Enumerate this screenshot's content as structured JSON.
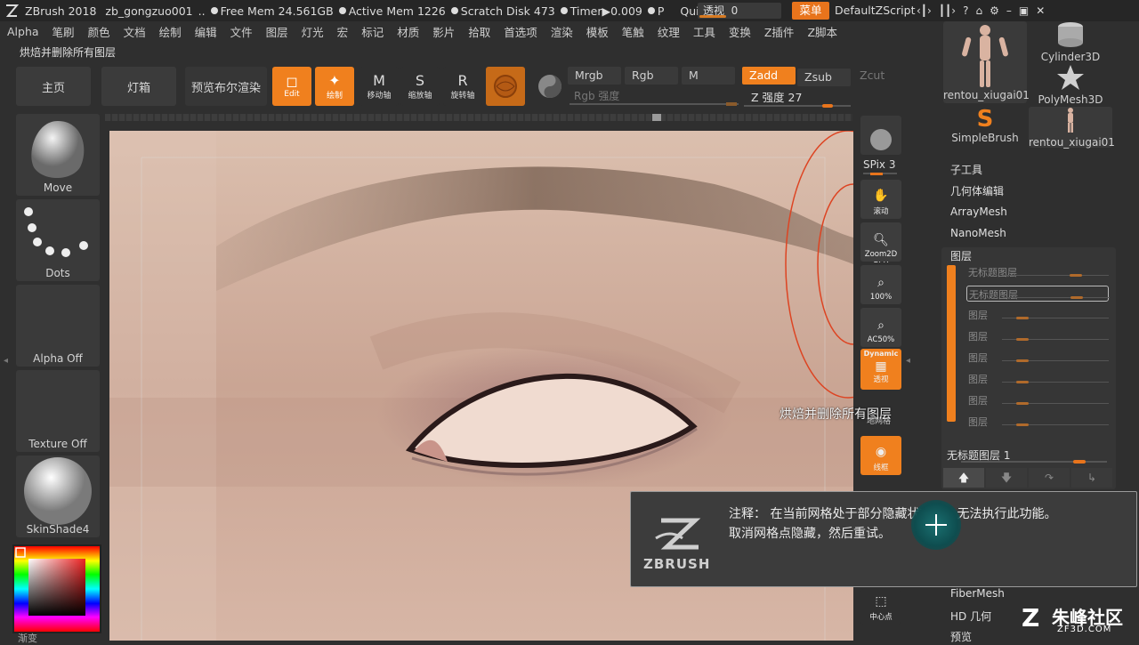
{
  "topbar": {
    "app": "ZBrush 2018",
    "doc": "zb_gongzuo001",
    "ellipsis": "..",
    "free_mem": "Free Mem 24.561GB",
    "active_mem": "Active Mem 1226",
    "scratch": "Scratch Disk 473",
    "timer": "Timer▶0.009",
    "p": "P",
    "quicksave": "QuickSave",
    "persp_label": "透视",
    "persp_value": "0",
    "menu_btn": "菜单",
    "default_script": "DefaultZScript"
  },
  "menubar": [
    "Alpha",
    "笔刷",
    "颜色",
    "文档",
    "绘制",
    "编辑",
    "文件",
    "图层",
    "灯光",
    "宏",
    "标记",
    "材质",
    "影片",
    "拾取",
    "首选项",
    "渲染",
    "模板",
    "笔触",
    "纹理",
    "工具",
    "变换",
    "Z插件",
    "Z脚本"
  ],
  "note_line": "烘焙并删除所有图层",
  "nav": {
    "home": "主页",
    "lightbox": "灯箱",
    "bpr": "预览布尔渲染"
  },
  "tools": {
    "edit": "Edit",
    "draw": "绘制",
    "move": "移动轴",
    "scale": "缩放轴",
    "rotate": "旋转轴"
  },
  "controls": {
    "mrgb": "Mrgb",
    "rgb": "Rgb",
    "m": "M",
    "zadd": "Zadd",
    "zsub": "Zsub",
    "zcut": "Zcut",
    "rgb_int": "Rgb 强度",
    "z_int": "Z 强度 27"
  },
  "left_tiles": {
    "brush": "Move",
    "stroke": "Dots",
    "alpha": "Alpha Off",
    "texture": "Texture Off",
    "material": "SkinShade4",
    "gradient": "渐变"
  },
  "right_tools": {
    "bpr": "BPR",
    "spix": "SPix 3",
    "scroll": "滚动",
    "zoom2d": "Zoom2D",
    "p100": "100%",
    "ac50": "AC50%",
    "dynamic": "Dynamic",
    "persp": "透视",
    "floor": "地网格",
    "polyframe": "线框",
    "localsym": "中心点"
  },
  "tool_thumbs": [
    {
      "name": "rentou_xiugai01"
    },
    {
      "name": "Cylinder3D"
    },
    {
      "name": "PolyMesh3D"
    },
    {
      "name": "SimpleBrush"
    },
    {
      "name": "rentou_xiugai01"
    }
  ],
  "right_list": {
    "subtool": "子工具",
    "geometry": "几何体编辑",
    "arraymesh": "ArrayMesh",
    "nanomesh": "NanoMesh",
    "layers": "图层",
    "fibermesh": "FiberMesh",
    "hd": "HD 几何",
    "preview": "预览"
  },
  "layer_rows": [
    "无标题图层",
    "无标题图层",
    "图层",
    "图层",
    "图层",
    "图层",
    "图层",
    "图层"
  ],
  "layer_current": "无标题图层 1",
  "tooltip": "烘焙并删除所有图层",
  "popup": {
    "line1": "注释： 在当前网格处于部分隐藏状态时，无法执行此功能。",
    "line2": "取消网格点隐藏，然后重试。",
    "logo_text": "ZBRUSH"
  },
  "watermark": {
    "brand": "朱峰社区",
    "url": "ZF3D.COM"
  },
  "colors": {
    "accent": "#f0801e",
    "panel": "#3a3a3a",
    "bg": "#2f2f2f"
  }
}
